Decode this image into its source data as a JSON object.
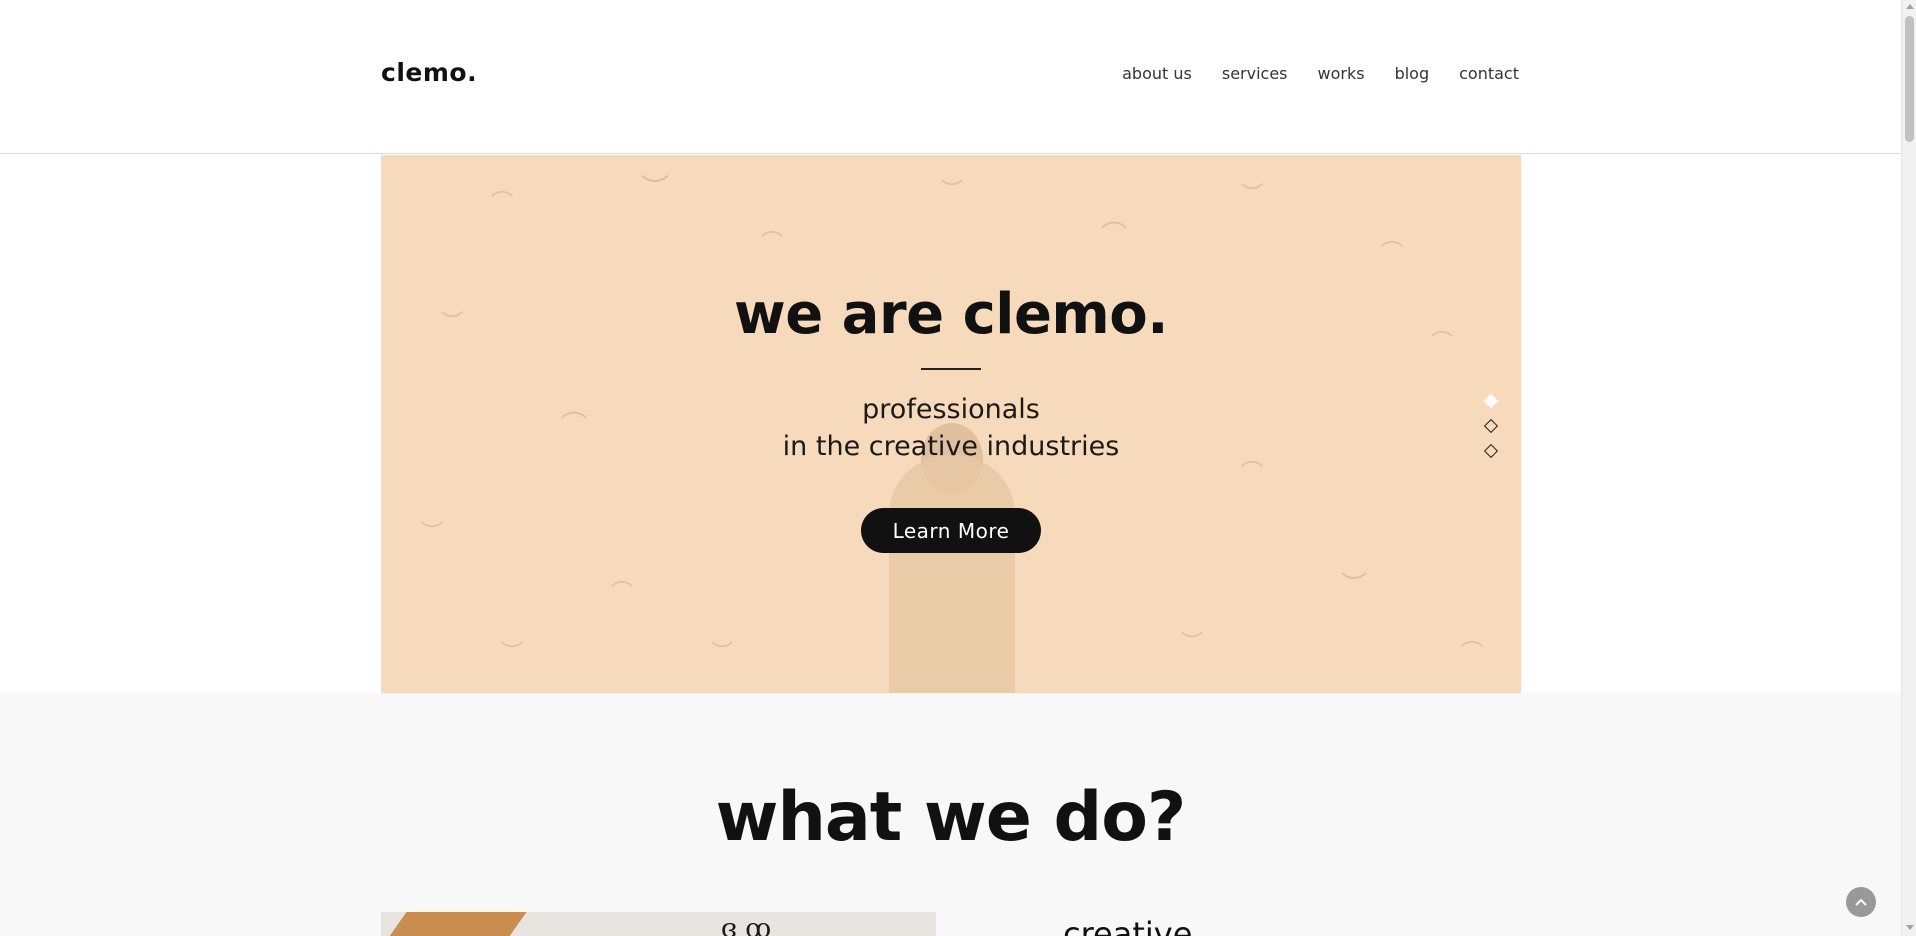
{
  "header": {
    "logo": "clemo.",
    "nav": [
      "about us",
      "services",
      "works",
      "blog",
      "contact"
    ]
  },
  "hero": {
    "title": "we are clemo.",
    "subtitle_line1": "professionals",
    "subtitle_line2": "in the creative industries",
    "cta_label": "Learn More",
    "background_color": "#f6dabb",
    "slides": 3,
    "active_slide": 1
  },
  "section": {
    "title": "what we do?",
    "card_title": "creative"
  },
  "icons": {
    "back_to_top": "chevron-up-icon",
    "slider_dot": "diamond-icon"
  }
}
